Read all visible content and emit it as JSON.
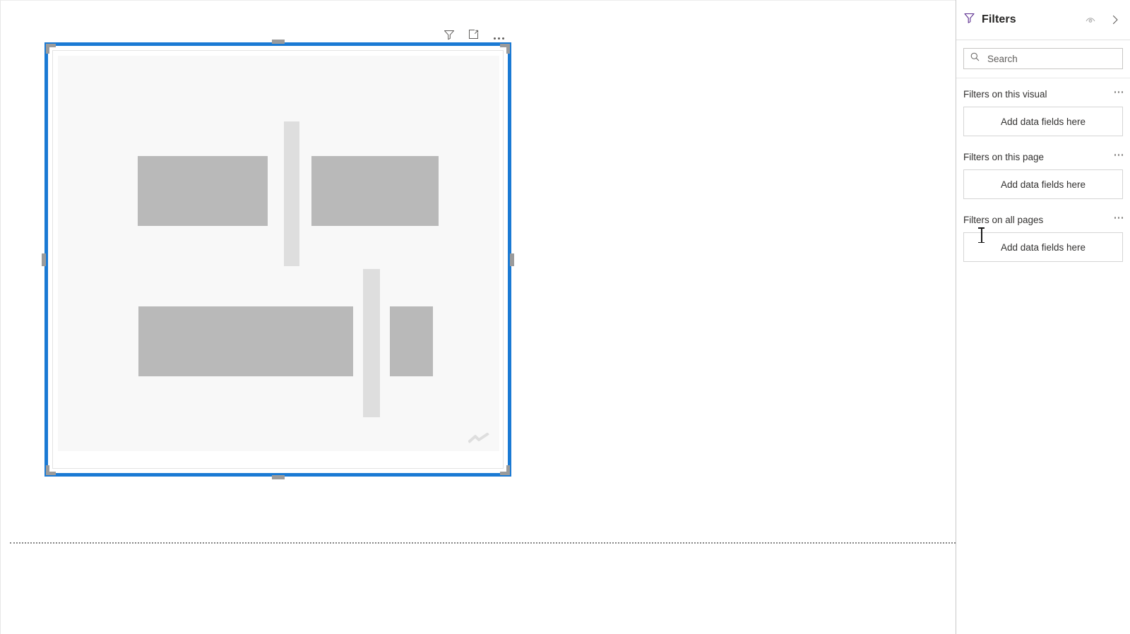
{
  "app": {
    "product": "Power BI report editor",
    "canvas_background": "#ffffff"
  },
  "report_canvas": {
    "name": "report-canvas",
    "page_separator": "dotted-line"
  },
  "visual": {
    "state": "selected",
    "type": "placeholder-visual",
    "selection_color": "#1a7ad4",
    "handle_color": "#9b9b9b",
    "skeleton": {
      "background": "#f8f8f8",
      "rect_color": "#b9b9b9",
      "bar_color": "#dedede",
      "shapes": [
        {
          "name": "upper-left-rect",
          "kind": "rect"
        },
        {
          "name": "upper-center-bar",
          "kind": "bar"
        },
        {
          "name": "upper-right-rect",
          "kind": "rect"
        },
        {
          "name": "lower-left-rect",
          "kind": "rect"
        },
        {
          "name": "lower-center-bar",
          "kind": "bar"
        },
        {
          "name": "lower-right-rect",
          "kind": "rect"
        }
      ],
      "corner_glyph": "zigzag-icon"
    },
    "handles": [
      "top-center",
      "bottom-center",
      "middle-left",
      "middle-right",
      "top-left",
      "top-right",
      "bottom-left",
      "bottom-right"
    ],
    "header_actions": [
      {
        "name": "filter-icon",
        "tooltip": "Filters"
      },
      {
        "name": "focus-mode-icon",
        "tooltip": "Focus mode"
      },
      {
        "name": "more-options-icon",
        "tooltip": "More options"
      }
    ]
  },
  "filters_pane": {
    "title": "Filters",
    "icon": "filter-funnel-icon",
    "actions": [
      {
        "name": "hide-filter-pane-eye-icon",
        "label": ""
      },
      {
        "name": "collapse-pane-chevron-icon",
        "label": ""
      }
    ],
    "search": {
      "placeholder": "Search",
      "value": "",
      "icon": "search-icon"
    },
    "sections": [
      {
        "title": "Filters on this visual",
        "dropzone_label": "Add data fields here",
        "menu": "more-options"
      },
      {
        "title": "Filters on this page",
        "dropzone_label": "Add data fields here",
        "menu": "more-options"
      },
      {
        "title": "Filters on all pages",
        "dropzone_label": "Add data fields here",
        "menu": "more-options"
      }
    ]
  },
  "cursor": {
    "type": "text-ibeam",
    "over": "Filters on all pages"
  }
}
